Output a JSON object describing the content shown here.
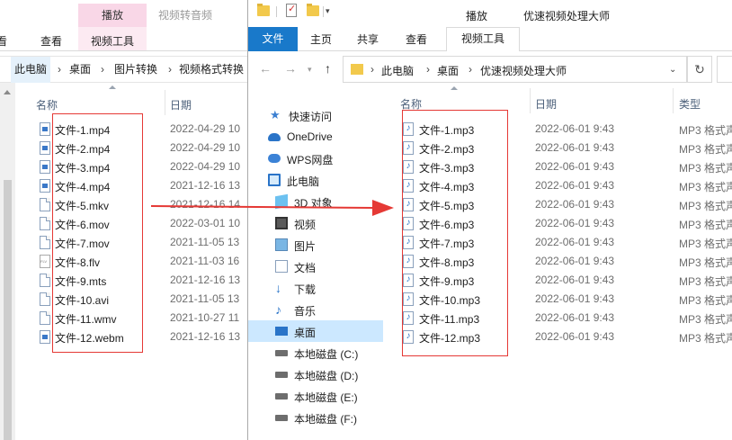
{
  "back_window": {
    "ribbon": {
      "context_tab": "播放",
      "context_title": "视频转音频",
      "tabs": [
        "看",
        "查看",
        "视频工具"
      ]
    },
    "breadcrumb": [
      "此电脑",
      "桌面",
      "图片转换",
      "视频格式转换"
    ],
    "columns": {
      "name": "名称",
      "date": "日期"
    },
    "files": [
      {
        "name": "文件-1.mp4",
        "date": "2022-04-29 10",
        "icon": "video-file-icon"
      },
      {
        "name": "文件-2.mp4",
        "date": "2022-04-29 10",
        "icon": "video-file-icon"
      },
      {
        "name": "文件-3.mp4",
        "date": "2022-04-29 10",
        "icon": "video-file-icon"
      },
      {
        "name": "文件-4.mp4",
        "date": "2021-12-16 13",
        "icon": "video-file-icon"
      },
      {
        "name": "文件-5.mkv",
        "date": "2021-12-16 14",
        "icon": "generic-file-icon"
      },
      {
        "name": "文件-6.mov",
        "date": "2022-03-01 10",
        "icon": "generic-file-icon"
      },
      {
        "name": "文件-7.mov",
        "date": "2021-11-05 13",
        "icon": "generic-file-icon"
      },
      {
        "name": "文件-8.flv",
        "date": "2021-11-03 16",
        "icon": "flv-file-icon"
      },
      {
        "name": "文件-9.mts",
        "date": "2021-12-16 13",
        "icon": "generic-file-icon"
      },
      {
        "name": "文件-10.avi",
        "date": "2021-11-05 13",
        "icon": "generic-file-icon"
      },
      {
        "name": "文件-11.wmv",
        "date": "2021-10-27 11",
        "icon": "generic-file-icon"
      },
      {
        "name": "文件-12.webm",
        "date": "2021-12-16 13",
        "icon": "video-file-icon"
      }
    ]
  },
  "front_window": {
    "title": "优速视频处理大师",
    "ribbon": {
      "context_tab": "播放",
      "file_tab": "文件",
      "tabs": [
        "主页",
        "共享",
        "查看"
      ],
      "active_tab": "视频工具"
    },
    "breadcrumb": [
      "此电脑",
      "桌面",
      "优速视频处理大师"
    ],
    "nav_pane": [
      {
        "label": "快速访问",
        "icon": "star-icon"
      },
      {
        "label": "OneDrive",
        "icon": "cloud-icon"
      },
      {
        "label": "WPS网盘",
        "icon": "wps-cloud-icon"
      },
      {
        "label": "此电脑",
        "icon": "pc-icon"
      },
      {
        "label": "3D 对象",
        "icon": "3d-objects-icon"
      },
      {
        "label": "视频",
        "icon": "videos-icon"
      },
      {
        "label": "图片",
        "icon": "pictures-icon"
      },
      {
        "label": "文档",
        "icon": "documents-icon"
      },
      {
        "label": "下载",
        "icon": "download-icon"
      },
      {
        "label": "音乐",
        "icon": "music-icon"
      },
      {
        "label": "桌面",
        "icon": "desktop-icon",
        "selected": true
      },
      {
        "label": "本地磁盘 (C:)",
        "icon": "drive-icon"
      },
      {
        "label": "本地磁盘 (D:)",
        "icon": "drive-icon"
      },
      {
        "label": "本地磁盘 (E:)",
        "icon": "drive-icon"
      },
      {
        "label": "本地磁盘 (F:)",
        "icon": "drive-icon"
      }
    ],
    "columns": {
      "name": "名称",
      "date": "日期",
      "type": "类型"
    },
    "files": [
      {
        "name": "文件-1.mp3",
        "date": "2022-06-01 9:43",
        "type": "MP3 格式声"
      },
      {
        "name": "文件-2.mp3",
        "date": "2022-06-01 9:43",
        "type": "MP3 格式声"
      },
      {
        "name": "文件-3.mp3",
        "date": "2022-06-01 9:43",
        "type": "MP3 格式声"
      },
      {
        "name": "文件-4.mp3",
        "date": "2022-06-01 9:43",
        "type": "MP3 格式声"
      },
      {
        "name": "文件-5.mp3",
        "date": "2022-06-01 9:43",
        "type": "MP3 格式声"
      },
      {
        "name": "文件-6.mp3",
        "date": "2022-06-01 9:43",
        "type": "MP3 格式声"
      },
      {
        "name": "文件-7.mp3",
        "date": "2022-06-01 9:43",
        "type": "MP3 格式声"
      },
      {
        "name": "文件-8.mp3",
        "date": "2022-06-01 9:43",
        "type": "MP3 格式声"
      },
      {
        "name": "文件-9.mp3",
        "date": "2022-06-01 9:43",
        "type": "MP3 格式声"
      },
      {
        "name": "文件-10.mp3",
        "date": "2022-06-01 9:43",
        "type": "MP3 格式声"
      },
      {
        "name": "文件-11.mp3",
        "date": "2022-06-01 9:43",
        "type": "MP3 格式声"
      },
      {
        "name": "文件-12.mp3",
        "date": "2022-06-01 9:43",
        "type": "MP3 格式声"
      }
    ]
  },
  "annotation": {
    "highlight_color": "#e53935",
    "arrow_color": "#e53935"
  }
}
